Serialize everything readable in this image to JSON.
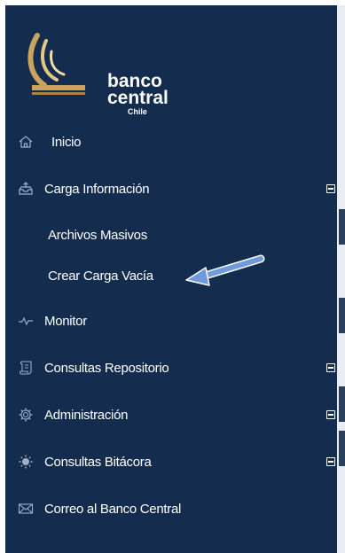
{
  "logo": {
    "line1": "banco",
    "line2": "central",
    "line3": "Chile",
    "accent": "#c9a45c"
  },
  "menu": {
    "inicio": {
      "label": "Inicio",
      "icon": "home-icon"
    },
    "carga": {
      "label": "Carga Información",
      "icon": "inbox-upload-icon",
      "expanded": true
    },
    "sub": [
      {
        "label": "Archivos Masivos"
      },
      {
        "label": "Crear Carga Vacía"
      }
    ],
    "monitor": {
      "label": "Monitor",
      "icon": "pulse-icon"
    },
    "consultas_repo": {
      "label": "Consultas Repositorio",
      "icon": "scroll-icon"
    },
    "administracion": {
      "label": "Administración",
      "icon": "gear-icon"
    },
    "consultas_bitacora": {
      "label": "Consultas Bitácora",
      "icon": "sun-gear-icon"
    },
    "correo": {
      "label": "Correo al Banco Central",
      "icon": "envelope-icon"
    }
  },
  "colors": {
    "sidebar_bg": "#142c4d",
    "text": "#ffffff",
    "annotation_arrow": "#6e9bdc"
  }
}
